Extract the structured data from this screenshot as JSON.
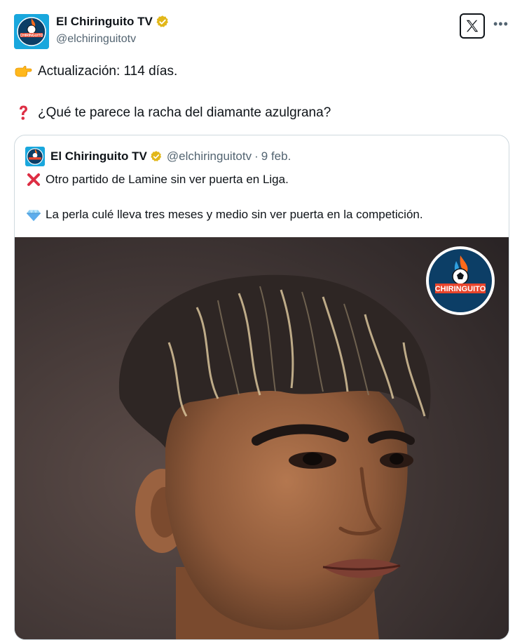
{
  "tweet": {
    "author": {
      "display_name": "El Chiringuito TV",
      "handle": "@elchiringuitotv",
      "verified": true,
      "avatar_text": "CHIRINGUITO"
    },
    "lines": [
      {
        "emoji": "backhand-index-pointing-right",
        "text": "Actualización: 114 días."
      },
      {
        "emoji": "red-question-mark",
        "text": "¿Qué te parece la racha del diamante azulgrana?"
      }
    ],
    "icons": {
      "brand": "x-logo-icon",
      "more": "more-options-icon"
    }
  },
  "quoted": {
    "author": {
      "display_name": "El Chiringuito TV",
      "handle": "@elchiringuitotv",
      "separator": "·",
      "date": "9 feb."
    },
    "lines": [
      {
        "emoji": "cross-mark",
        "text": "Otro partido de Lamine sin ver puerta en Liga."
      },
      {
        "emoji": "gem-stone",
        "text": "La perla culé lleva tres meses y medio sin ver puerta en la competición."
      }
    ],
    "image": {
      "subject": "close-up portrait of young footballer",
      "watermark_text": "CHIRINGUITO"
    }
  },
  "colors": {
    "text": "#0f1419",
    "secondary": "#536471",
    "border": "#cfd9de",
    "verified_gold": "#e2b719",
    "avatar_blue": "#19a7dd"
  }
}
